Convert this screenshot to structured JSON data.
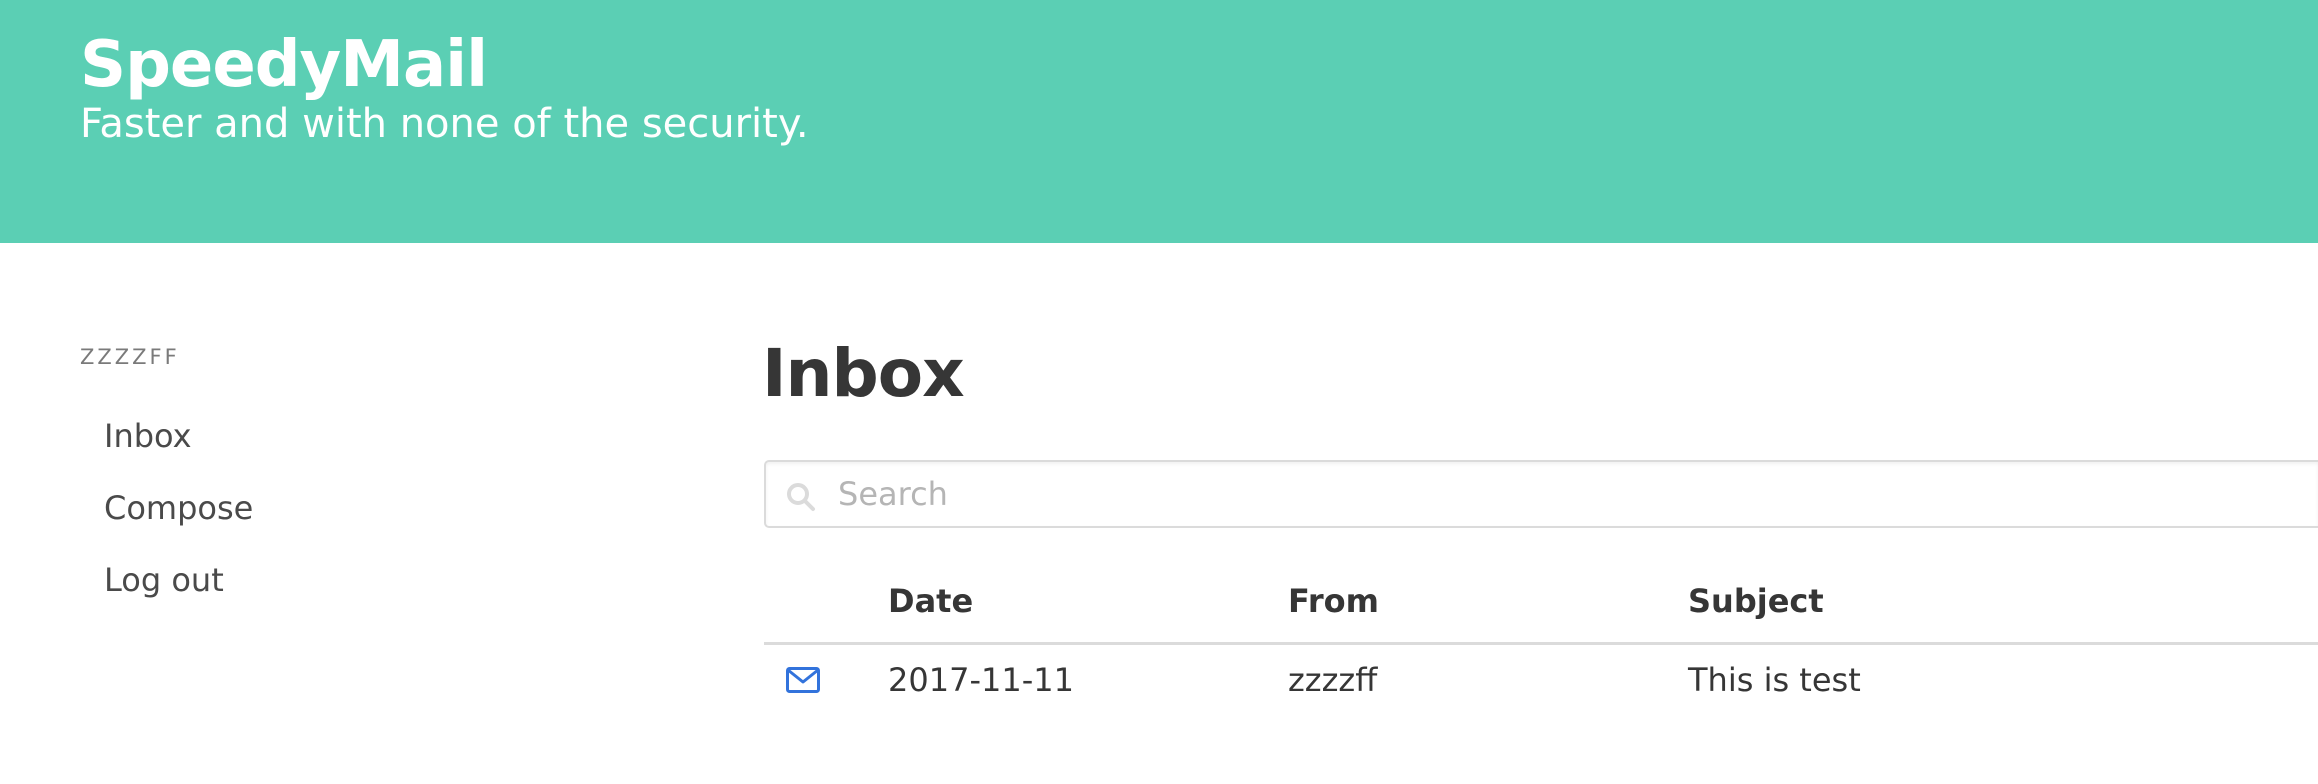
{
  "header": {
    "title": "SpeedyMail",
    "subtitle": "Faster and with none of the security."
  },
  "sidebar": {
    "user": "zzzzff",
    "items": [
      {
        "label": "Inbox"
      },
      {
        "label": "Compose"
      },
      {
        "label": "Log out"
      }
    ]
  },
  "main": {
    "title": "Inbox",
    "search": {
      "placeholder": "Search",
      "value": "",
      "icon": "search-icon"
    },
    "table": {
      "columns": [
        "",
        "Date",
        "From",
        "Subject"
      ],
      "rows": [
        {
          "icon": "envelope-icon",
          "date": "2017-11-11",
          "from": "zzzzff",
          "subject": "This is test"
        }
      ]
    }
  },
  "colors": {
    "hero": "#5bcfb4",
    "link_icon": "#3273dc",
    "text": "#363636"
  }
}
